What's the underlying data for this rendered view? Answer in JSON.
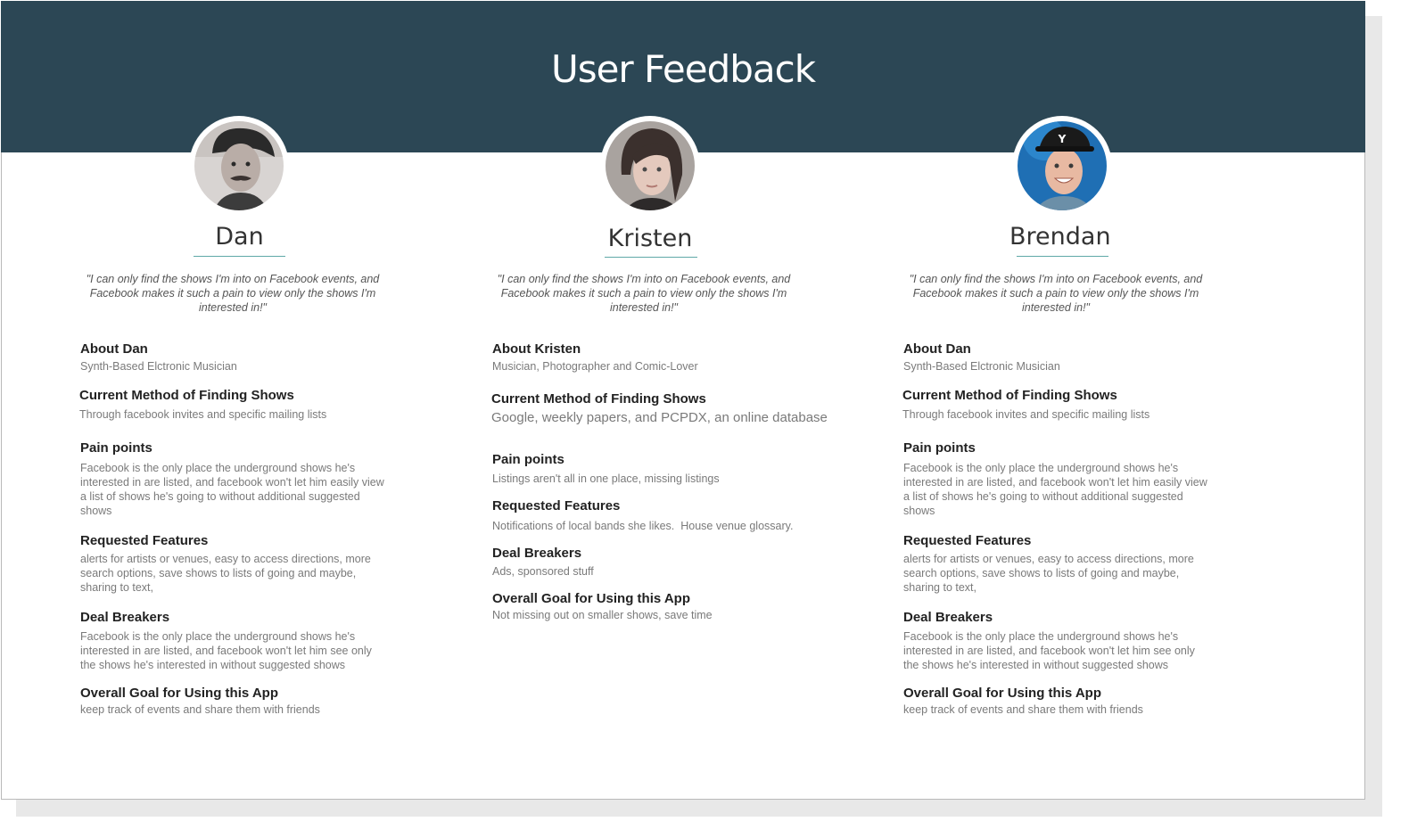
{
  "title": "User Feedback",
  "colors": {
    "header": "#2c4755",
    "accent": "#5fa9a8"
  },
  "personas": [
    {
      "name": "Dan",
      "avatar": "dan-photo",
      "quote": "\"I can only find the shows I'm into on Facebook events, and Facebook makes it such a pain to view only the shows I'm interested in!\"",
      "about_heading": "About Dan",
      "about": "Synth-Based Elctronic Musician",
      "method_heading": "Current Method of Finding Shows",
      "method": "Through facebook invites and specific mailing lists",
      "pain_heading": "Pain points",
      "pain": "Facebook is the only place the underground shows he's interested in are listed, and facebook won't let him easily view a list of shows he's going to without additional suggested shows",
      "features_heading": "Requested Features",
      "features": "alerts for artists or venues, easy to access directions, more search options, save shows to lists of going and maybe, sharing to text,",
      "breakers_heading": "Deal Breakers",
      "breakers": "Facebook is the only place the underground shows he's interested in are listed, and facebook won't let him see only the shows he's interested in without suggested shows",
      "goal_heading": "Overall Goal for Using this App",
      "goal": "keep track of events and share them with friends"
    },
    {
      "name": "Kristen",
      "avatar": "kristen-photo",
      "quote": "\"I can only find the shows I'm into on Facebook events, and Facebook makes it such a pain to view only the shows I'm interested in!\"",
      "about_heading": "About Kristen",
      "about": "Musician, Photographer and Comic-Lover",
      "method_heading": "Current Method of Finding Shows",
      "method": "Google, weekly papers, and PCPDX, an online database",
      "pain_heading": "Pain points",
      "pain": "Listings aren't all in one place, missing listings",
      "features_heading": "Requested Features",
      "features": "Notifications of local bands she likes.  House venue glossary.",
      "breakers_heading": "Deal Breakers",
      "breakers": "Ads, sponsored stuff",
      "goal_heading": "Overall Goal for Using this App",
      "goal": "Not missing out on smaller shows, save time"
    },
    {
      "name": "Brendan",
      "avatar": "brendan-photo",
      "quote": "\"I can only find the shows I'm into on Facebook events, and Facebook makes it such a pain to view only the shows I'm interested in!\"",
      "about_heading": "About Dan",
      "about": "Synth-Based Elctronic Musician",
      "method_heading": "Current Method of Finding Shows",
      "method": "Through facebook invites and specific mailing lists",
      "pain_heading": "Pain points",
      "pain": "Facebook is the only place the underground shows he's interested in are listed, and facebook won't let him easily view a list of shows he's going to without additional suggested shows",
      "features_heading": "Requested Features",
      "features": "alerts for artists or venues, easy to access directions, more search options, save shows to lists of going and maybe, sharing to text,",
      "breakers_heading": "Deal Breakers",
      "breakers": "Facebook is the only place the underground shows he's interested in are listed, and facebook won't let him see only the shows he's interested in without suggested shows",
      "goal_heading": "Overall Goal for Using this App",
      "goal": "keep track of events and share them with friends"
    }
  ]
}
